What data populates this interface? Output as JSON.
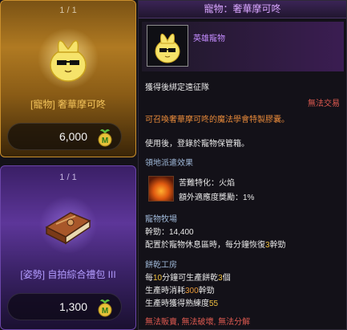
{
  "cards": [
    {
      "count": "1 / 1",
      "name": "[寵物] 奢華摩可咚",
      "price": "6,000",
      "currency_icon": "m-coin-icon"
    },
    {
      "count": "1 / 1",
      "name": "[姿勢] 自拍綜合禮包 III",
      "price": "1,300",
      "currency_icon": "m-coin-icon"
    }
  ],
  "tooltip": {
    "title": "寵物：奢華摩可咚",
    "type_label": "英雄寵物",
    "bind_text": "獲得後綁定遠征隊",
    "trade_text": "無法交易",
    "summon_text": "可召喚奢華摩可咚的魔法學會特製膠囊。",
    "use_text": "使用後，登錄於寵物保管箱。",
    "dispatch_heading": "領地派遣效果",
    "skill_name": "苦難特化：火焰",
    "skill_bonus": "額外適應度獎勵：1%",
    "ranch_heading": "寵物牧場",
    "stamina": "幹勁：14,400",
    "rest_pre": "配置於寵物休息區時，每分鐘恢復",
    "rest_num": "3",
    "rest_post": "幹勁",
    "bakery_heading": "餅乾工房",
    "line1_pre": "每",
    "line1_num": "10",
    "line1_mid": "分鐘可生產餅乾",
    "line1_num2": "3",
    "line1_post": "個",
    "line2_pre": "生產時消耗",
    "line2_num": "300",
    "line2_post": "幹勁",
    "line3_pre": "生產時獲得熟練度",
    "line3_num": "55",
    "restrictions": "無法販賣, 無法破壞, 無法分解"
  },
  "colors": {
    "gold_card": "#b07a22",
    "purple_card": "#5d3699",
    "title_purple": "#d9a6ff",
    "red": "#e05a50",
    "orange": "#e88a3a",
    "highlight": "#f0c040"
  }
}
